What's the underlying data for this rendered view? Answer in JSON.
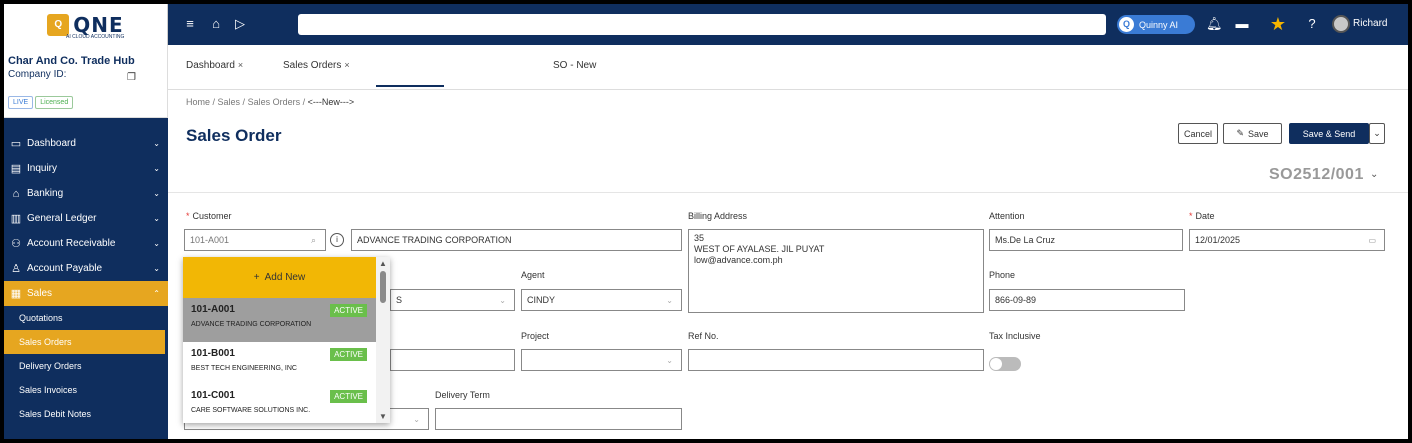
{
  "app": {
    "logo_text": "QNE",
    "logo_subtitle": "AI CLOUD ACCOUNTING",
    "assistant_label": "Quinny AI",
    "user_name": "Richard"
  },
  "company": {
    "name": "Char And Co. Trade Hub",
    "id_label": "Company ID:",
    "badge_live": "LIVE",
    "badge_licensed": "Licensed"
  },
  "sidebar": {
    "items": [
      {
        "label": "Dashboard",
        "icon": "monitor-icon"
      },
      {
        "label": "Inquiry",
        "icon": "document-icon"
      },
      {
        "label": "Banking",
        "icon": "bank-icon"
      },
      {
        "label": "General Ledger",
        "icon": "ledger-icon"
      },
      {
        "label": "Account Receivable",
        "icon": "receivable-icon"
      },
      {
        "label": "Account Payable",
        "icon": "payable-icon"
      },
      {
        "label": "Sales",
        "icon": "sales-icon"
      }
    ],
    "sales_sub": [
      "Quotations",
      "Sales Orders",
      "Delivery Orders",
      "Sales Invoices",
      "Sales Debit Notes"
    ]
  },
  "tabs": [
    {
      "label": "Dashboard",
      "close": "×"
    },
    {
      "label": "Sales Orders",
      "close": "×"
    },
    {
      "label": "SO - New",
      "close": ""
    }
  ],
  "breadcrumb": {
    "items": [
      "Home",
      "Sales",
      "Sales Orders"
    ],
    "current": "<---New--->"
  },
  "page": {
    "title": "Sales Order",
    "so_number": "SO2512/001"
  },
  "actions": {
    "cancel": "Cancel",
    "save": "Save",
    "save_send": "Save & Send"
  },
  "form": {
    "customer_label": "Customer",
    "customer_code_placeholder": "101-A001",
    "customer_name": "ADVANCE TRADING CORPORATION",
    "billing_label": "Billing Address",
    "billing_lines": [
      "35",
      "WEST OF AYALASE. JIL PUYAT",
      "low@advance.com.ph"
    ],
    "attention_label": "Attention",
    "attention_value": "Ms.De La Cruz",
    "date_label": "Date",
    "date_value": "12/01/2025",
    "agent_label": "Agent",
    "agent_value": "CINDY",
    "partial_hidden_value": "S",
    "phone_label": "Phone",
    "phone_value": "866-09-89",
    "project_label": "Project",
    "ref_label": "Ref No.",
    "tax_label": "Tax Inclusive",
    "delivery_term_label": "Delivery Term"
  },
  "dropdown": {
    "add_new": "Add New",
    "options": [
      {
        "code": "101-A001",
        "name": "ADVANCE TRADING CORPORATION",
        "status": "ACTIVE"
      },
      {
        "code": "101-B001",
        "name": "BEST TECH ENGINEERING, INC",
        "status": "ACTIVE"
      },
      {
        "code": "101-C001",
        "name": "CARE SOFTWARE SOLUTIONS INC.",
        "status": "ACTIVE"
      }
    ]
  },
  "colors": {
    "navy": "#0f2e5e",
    "accent": "#e6a620",
    "active_badge": "#6abf4b"
  }
}
